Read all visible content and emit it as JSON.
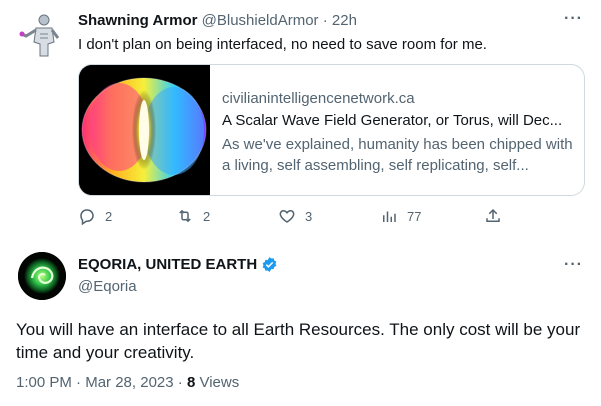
{
  "reply": {
    "display_name": "Shawning Armor",
    "handle": "@BlushieldArmor",
    "separator": "·",
    "time": "22h",
    "text": "I don't plan on being interfaced, no need to save room for me.",
    "card": {
      "domain": "civilianintelligencenetwork.ca",
      "title": "A Scalar Wave Field Generator, or Torus, will Dec...",
      "description": "As we've explained, humanity has been chipped with a living, self assembling, self replicating, self..."
    },
    "actions": {
      "replies": "2",
      "retweets": "2",
      "likes": "3",
      "views": "77"
    }
  },
  "main": {
    "display_name": "EQORIA, UNITED EARTH",
    "handle": "@Eqoria",
    "text": "You will have an interface to all Earth Resources. The only cost will be your time and your creativity.",
    "time": "1:00 PM",
    "date": "Mar 28, 2023",
    "separator": "·",
    "views_count": "8",
    "views_label": "Views"
  },
  "colors": {
    "verified": "#1d9bf0",
    "secondary_text": "#536471",
    "border": "#cfd9de"
  }
}
